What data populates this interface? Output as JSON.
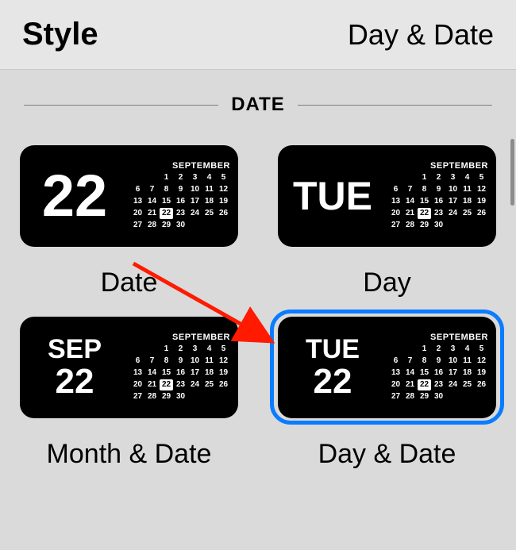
{
  "header": {
    "title": "Style",
    "value": "Day & Date"
  },
  "section": {
    "label": "DATE"
  },
  "calendar": {
    "month_short": "SEP",
    "month_full": "SEPTEMBER",
    "dow_short": "TUE",
    "today": 22,
    "weeks": [
      [
        "",
        "",
        "1",
        "2",
        "3",
        "4",
        "5"
      ],
      [
        "6",
        "7",
        "8",
        "9",
        "10",
        "11",
        "12"
      ],
      [
        "13",
        "14",
        "15",
        "16",
        "17",
        "18",
        "19"
      ],
      [
        "20",
        "21",
        "22",
        "23",
        "24",
        "25",
        "26"
      ],
      [
        "27",
        "28",
        "29",
        "30",
        "",
        "",
        ""
      ]
    ]
  },
  "options": {
    "date": {
      "label": "Date"
    },
    "day": {
      "label": "Day"
    },
    "month_date": {
      "label": "Month & Date"
    },
    "day_date": {
      "label": "Day & Date"
    }
  },
  "selected_option": "day_date"
}
